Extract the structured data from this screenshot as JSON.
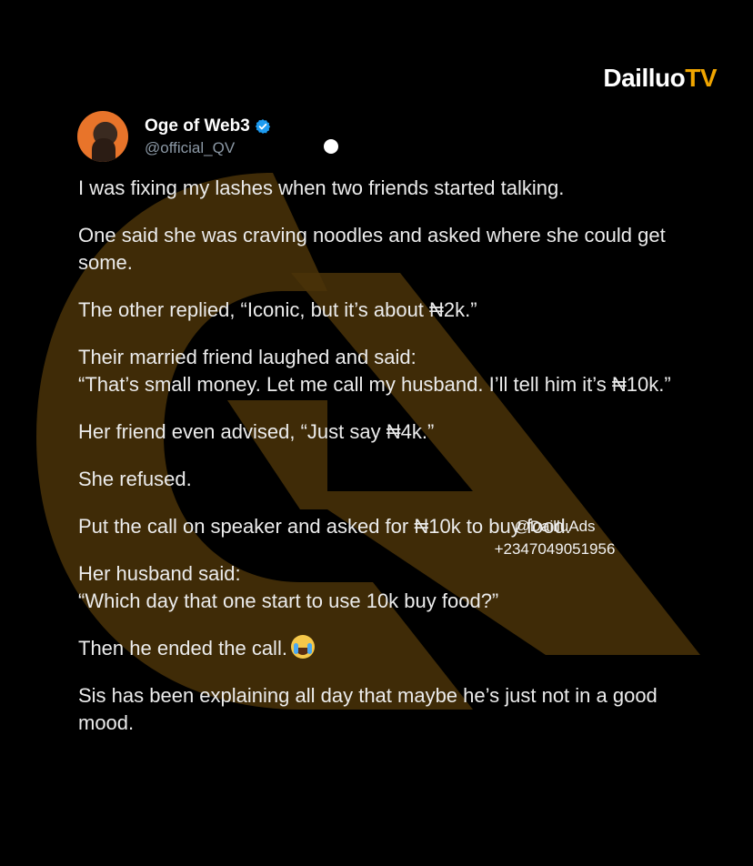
{
  "brand": {
    "main": "Dailluo",
    "accent": "TV",
    "accent_color": "#f0a500"
  },
  "tweet": {
    "author_name": "Oge of Web3",
    "handle": "@official_QV",
    "verified_icon": "verified-badge-icon",
    "paragraphs": [
      "I was fixing my lashes when two friends started talking.",
      "One said she was craving noodles and asked where she could get some.",
      "The other replied, “Iconic, but it’s about ₦2k.”",
      "Their married friend laughed and said:\n“That’s small money. Let me call my husband. I’ll tell him it’s ₦10k.”",
      "Her friend even advised, “Just say ₦4k.”",
      "She refused.",
      "Put the call on speaker and asked for ₦10k to buy food.",
      "Her husband said:\n“Which day that one start to use 10k buy food?”",
      "Then he ended the call.",
      "Sis has been explaining all day that maybe he’s just not in a good mood."
    ],
    "emoji_icon": "loudly-crying-face-icon"
  },
  "ad_contact": {
    "handle": "@DailluAds",
    "phone": "+2347049051956"
  },
  "colors": {
    "background": "#000000",
    "watermark": "#5a3d0a",
    "verified": "#1d9bf0",
    "text": "#ececec",
    "handle": "#8b98a5"
  }
}
